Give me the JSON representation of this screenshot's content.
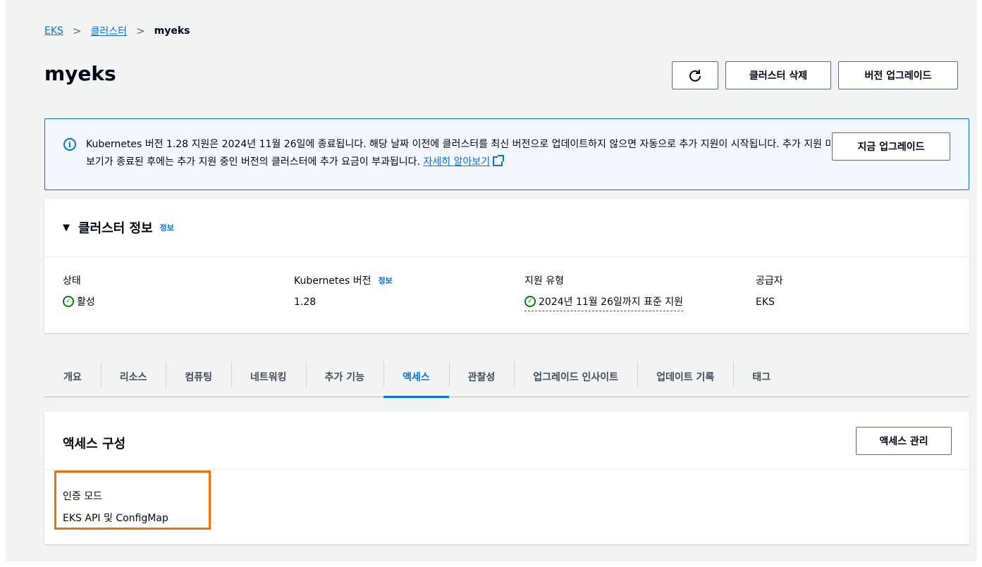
{
  "breadcrumb": {
    "items": [
      "EKS",
      "클러스터"
    ],
    "current": "myeks",
    "separator": ">"
  },
  "header": {
    "title": "myeks",
    "refresh_icon": "refresh-icon",
    "delete_label": "클러스터 삭제",
    "upgrade_label": "버전 업그레이드"
  },
  "banner": {
    "icon": "info-icon",
    "icon_glyph": "i",
    "text": "Kubernetes 버전 1.28 지원은 2024년 11월 26일에 종료됩니다. 해당 날짜 이전에 클러스터를 최신 버전으로 업데이트하지 않으면 자동으로 추가 지원이 시작됩니다. 추가 지원 미리보기가 종료된 후에는 추가 지원 중인 버전의 클러스터에 추가 요금이 부과됩니다.",
    "link_text": "자세히 알아보기",
    "button_label": "지금 업그레이드"
  },
  "cluster_info": {
    "caret": "▼",
    "title": "클러스터 정보",
    "info_link": "정보",
    "fields": [
      {
        "label": "상태",
        "value": "활성",
        "status": "ok"
      },
      {
        "label": "Kubernetes 버전",
        "info_link": "정보",
        "value": "1.28"
      },
      {
        "label": "지원 유형",
        "value": "2024년 11월 26일까지 표준 지원",
        "status": "ok"
      },
      {
        "label": "공급자",
        "value": "EKS"
      }
    ]
  },
  "tabs": {
    "items": [
      "개요",
      "리소스",
      "컴퓨팅",
      "네트워킹",
      "추가 기능",
      "액세스",
      "관찰성",
      "업그레이드 인사이트",
      "업데이트 기록",
      "태그"
    ],
    "active": "액세스"
  },
  "access": {
    "title": "액세스 구성",
    "manage_label": "액세스 관리",
    "auth_mode_label": "인증 모드",
    "auth_mode_value": "EKS API 및 ConfigMap"
  },
  "colors": {
    "link": "#0972d3",
    "success": "#037f0c",
    "highlight": "#ec7211",
    "background": "#f2f3f3"
  }
}
